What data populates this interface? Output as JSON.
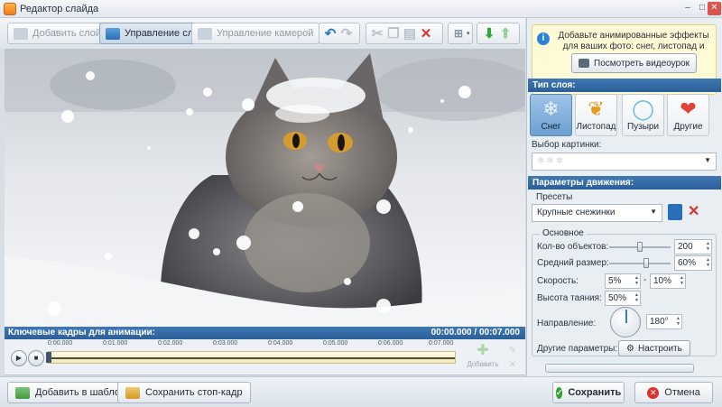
{
  "window": {
    "title": "Редактор слайда",
    "controls": {
      "minimize": "–",
      "maximize": "□",
      "close": "✕"
    }
  },
  "toolbar": {
    "add_layer": "Добавить слой",
    "layers": "Управление слоями",
    "camera": "Управление камерой"
  },
  "info": {
    "text": "Добавьте анимированные эффекты для ваших фото: снег, листопад и другие.",
    "video_button": "Посмотреть видеоурок"
  },
  "layer_type": {
    "header": "Тип слоя:",
    "options": [
      {
        "label": "Снег",
        "icon": "snowflake-icon",
        "selected": true
      },
      {
        "label": "Листопад",
        "icon": "leaf-icon",
        "selected": false
      },
      {
        "label": "Пузыри",
        "icon": "bubble-icon",
        "selected": false
      },
      {
        "label": "Другие",
        "icon": "star-heart-icon",
        "selected": false
      }
    ],
    "picture_label": "Выбор картинки:"
  },
  "motion": {
    "header": "Параметры движения:",
    "presets_label": "Пресеты",
    "preset_value": "Крупные снежинки",
    "basic_label": "Основное",
    "count_label": "Кол-во объектов:",
    "count_value": "200",
    "count_level": 0.5,
    "size_label": "Средний размер:",
    "size_value": "60%",
    "size_level": 0.6,
    "speed_label": "Скорость:",
    "speed_min": "5%",
    "speed_dash": "-",
    "speed_max": "10%",
    "melt_label": "Высота таяния:",
    "melt_value": "50%",
    "direction_label": "Направление:",
    "direction_value": "180°",
    "other_label": "Другие параметры:",
    "configure_button": "Настроить"
  },
  "timeline": {
    "title": "Ключевые кадры для анимации:",
    "time": "00:00.000 / 00:07.000",
    "ticks": [
      "0:00.000",
      "0:01.000",
      "0:02.000",
      "0:03.000",
      "0:04.000",
      "0:05.000",
      "0:06.000",
      "0:07.000"
    ],
    "add_keyframe": "Добавить"
  },
  "bottom": {
    "add_template": "Добавить в шаблоны",
    "save_frame": "Сохранить стоп-кадр",
    "save": "Сохранить",
    "cancel": "Отмена"
  },
  "colors": {
    "accent": "#2c5f98",
    "save_green": "#2fa12f",
    "cancel_red": "#d9332f",
    "info_yellow": "#fffad6"
  }
}
